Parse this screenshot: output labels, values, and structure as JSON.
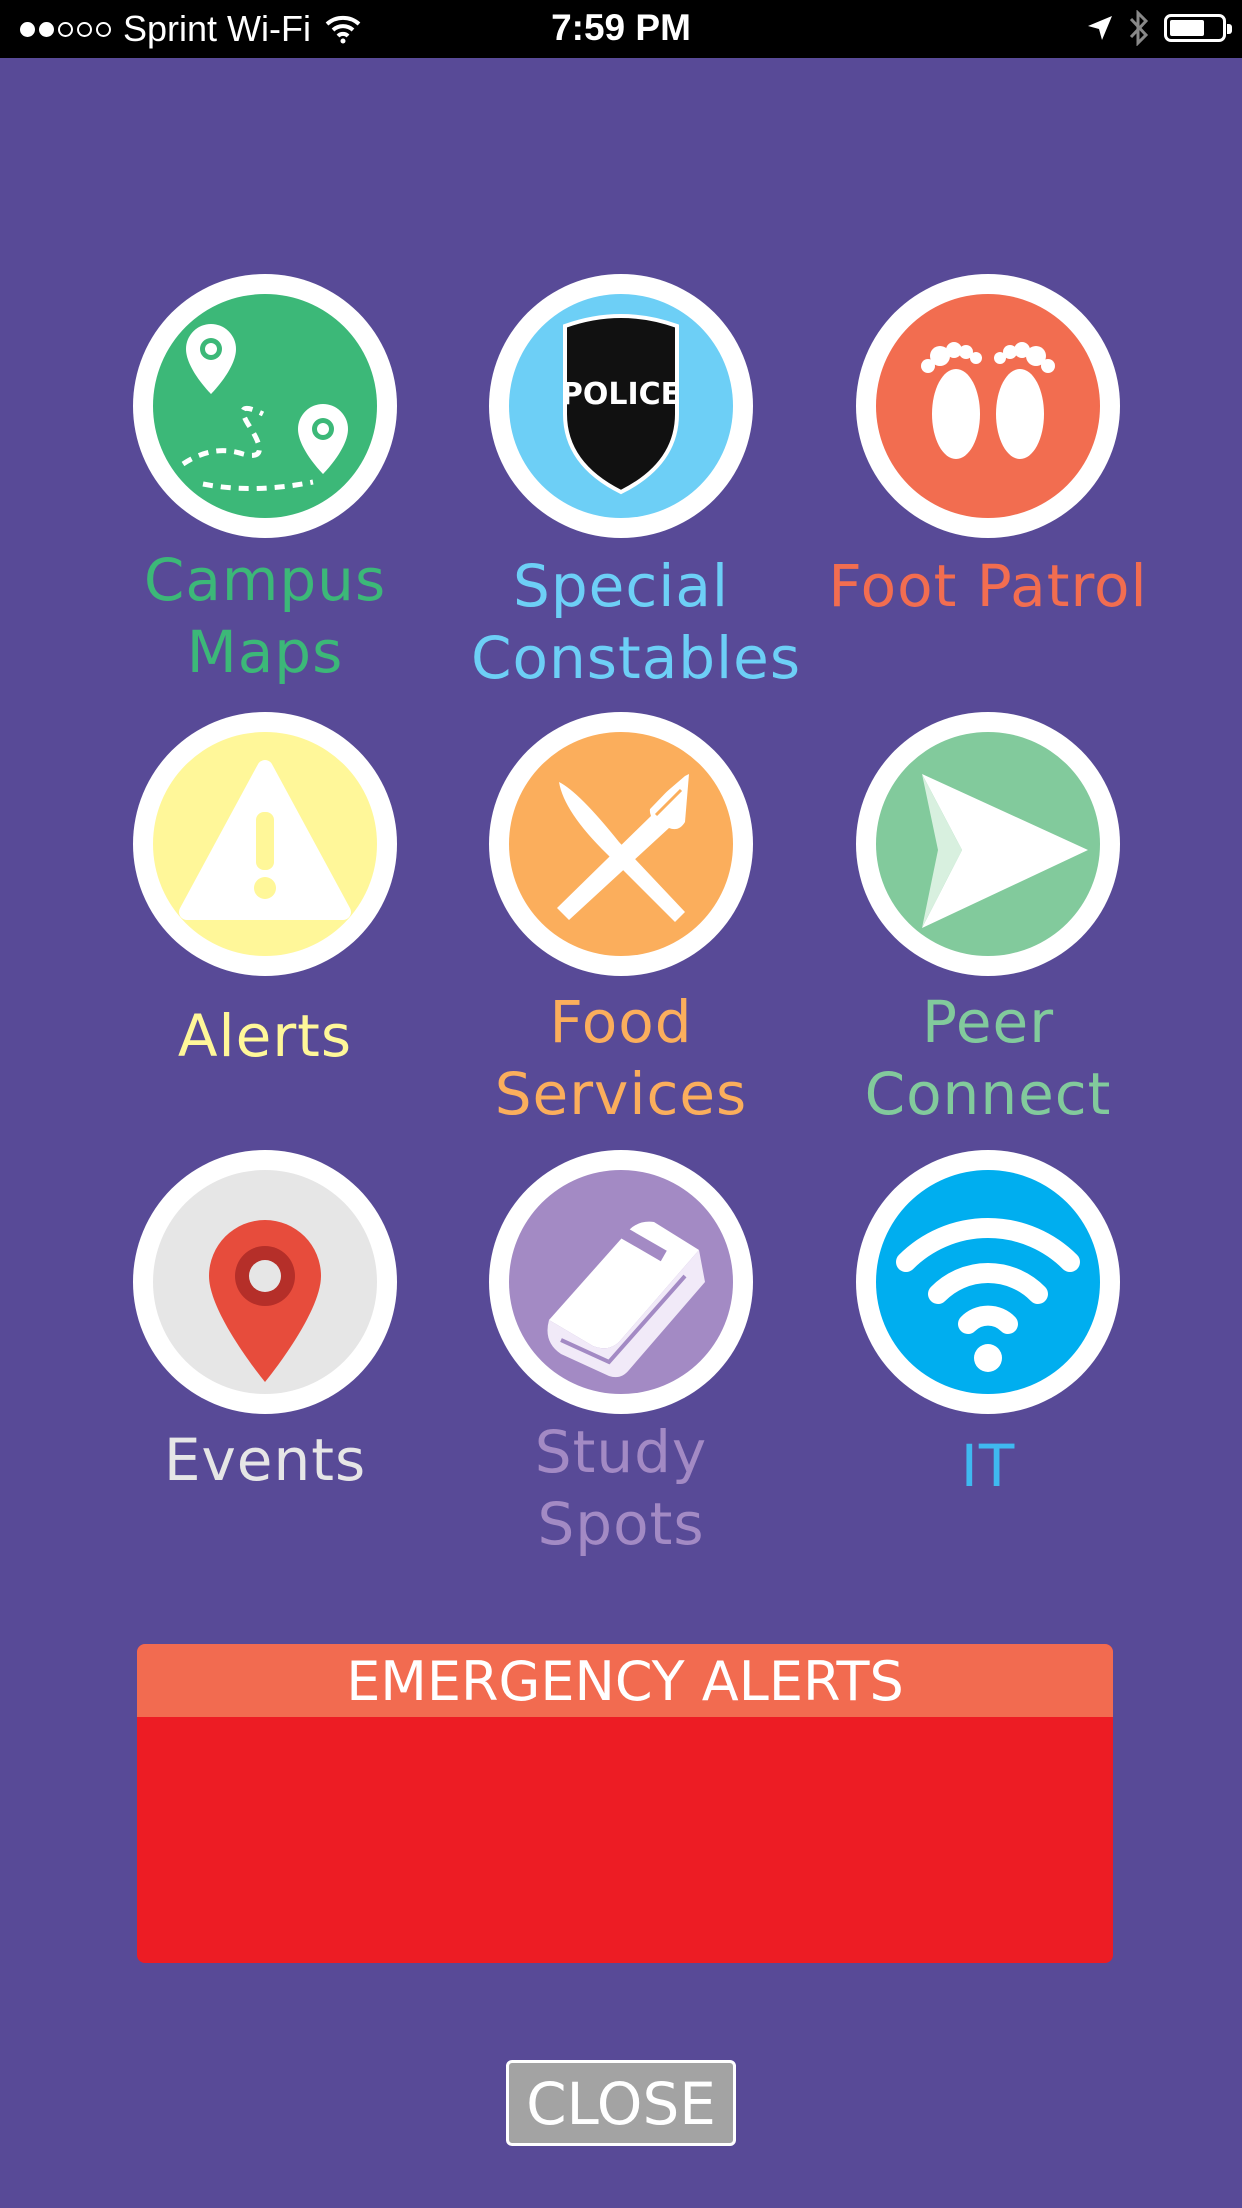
{
  "status_bar": {
    "carrier": "Sprint Wi-Fi",
    "time": "7:59 PM",
    "signal_icon": "signal-dots-icon",
    "wifi_icon": "wifi-icon",
    "location_icon": "location-arrow-icon",
    "bluetooth_icon": "bluetooth-icon",
    "battery_icon": "battery-icon"
  },
  "menu": {
    "items": [
      {
        "label_line1": "Campus",
        "label_line2": "Maps",
        "color": "#3cb878",
        "icon": "map-route-icon"
      },
      {
        "label_line1": "Special",
        "label_line2": "Constables",
        "color": "#6dcff6",
        "icon": "police-badge-icon",
        "badge_text": "POLICE"
      },
      {
        "label_line1": "Foot Patrol",
        "label_line2": "",
        "color": "#f26d50",
        "icon": "footprints-icon"
      },
      {
        "label_line1": "Alerts",
        "label_line2": "",
        "color": "#fff799",
        "icon": "warning-icon"
      },
      {
        "label_line1": "Food",
        "label_line2": "Services",
        "color": "#fbae5c",
        "icon": "knife-fork-icon"
      },
      {
        "label_line1": "Peer",
        "label_line2": "Connect",
        "color": "#82ca9c",
        "icon": "send-arrow-icon"
      },
      {
        "label_line1": "Events",
        "label_line2": "",
        "color": "#e6e6e6",
        "icon": "map-pin-icon"
      },
      {
        "label_line1": "Study",
        "label_line2": "Spots",
        "color": "#a38ac4",
        "icon": "book-icon"
      },
      {
        "label_line1": "IT",
        "label_line2": "",
        "color": "#00aeef",
        "icon": "wifi-signal-icon"
      }
    ]
  },
  "emergency": {
    "title": "EMERGENCY ALERTS",
    "header_color": "#f26b50",
    "body_color": "#ed1c24"
  },
  "close_label": "CLOSE"
}
